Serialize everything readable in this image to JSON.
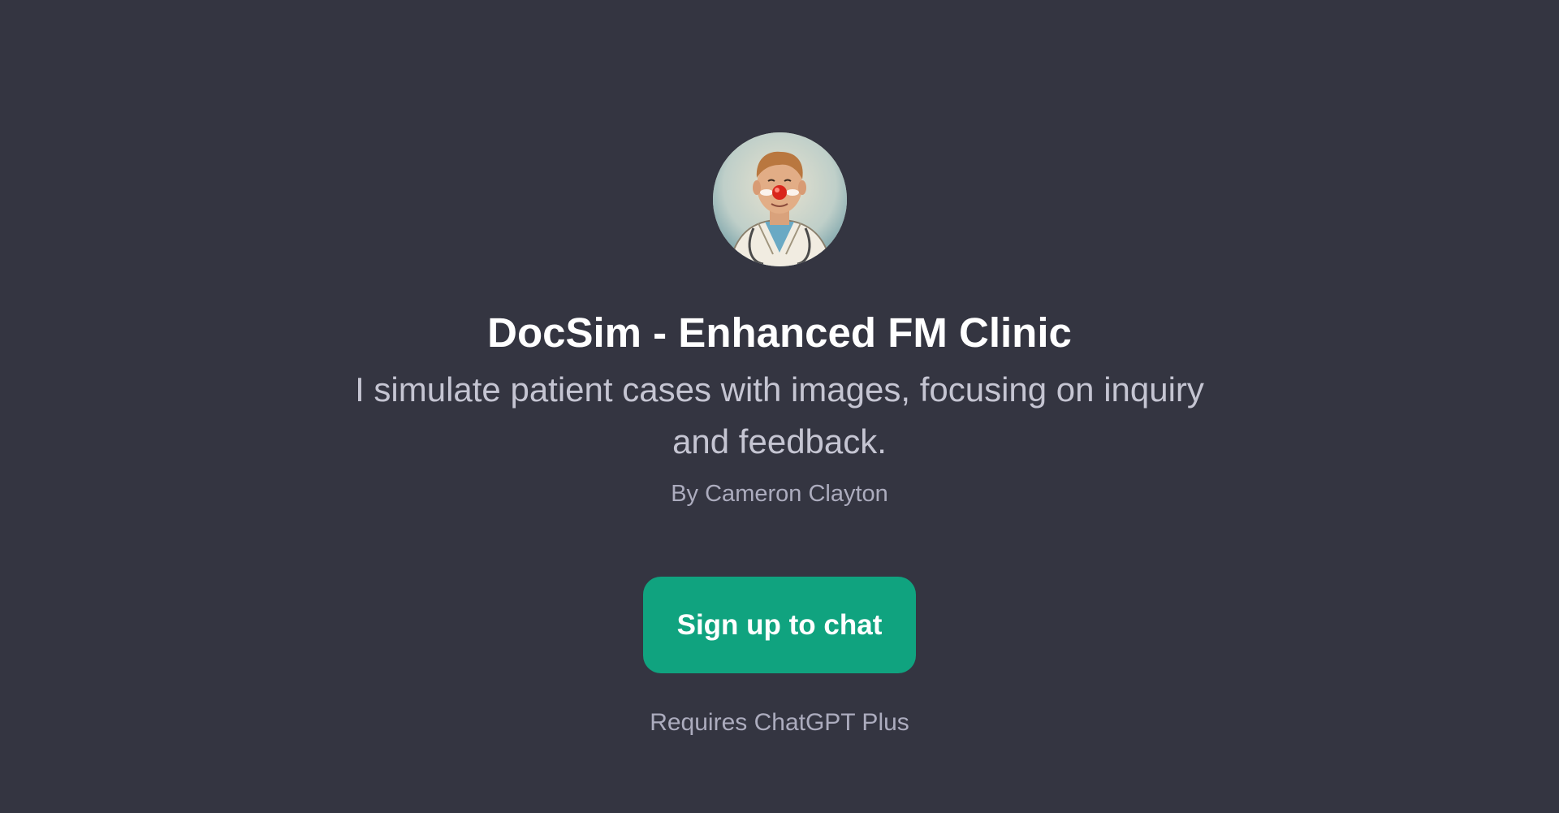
{
  "gpt": {
    "avatar_icon": "doctor-clown-portrait",
    "title": "DocSim - Enhanced FM Clinic",
    "description": "I simulate patient cases with images, focusing on inquiry and feedback.",
    "author": "By Cameron Clayton"
  },
  "actions": {
    "signup_label": "Sign up to chat",
    "requirement_note": "Requires ChatGPT Plus"
  },
  "colors": {
    "background": "#343541",
    "accent": "#10a37f",
    "title": "#ffffff",
    "secondary_text": "#c5c5d2",
    "muted_text": "#acacbe"
  }
}
